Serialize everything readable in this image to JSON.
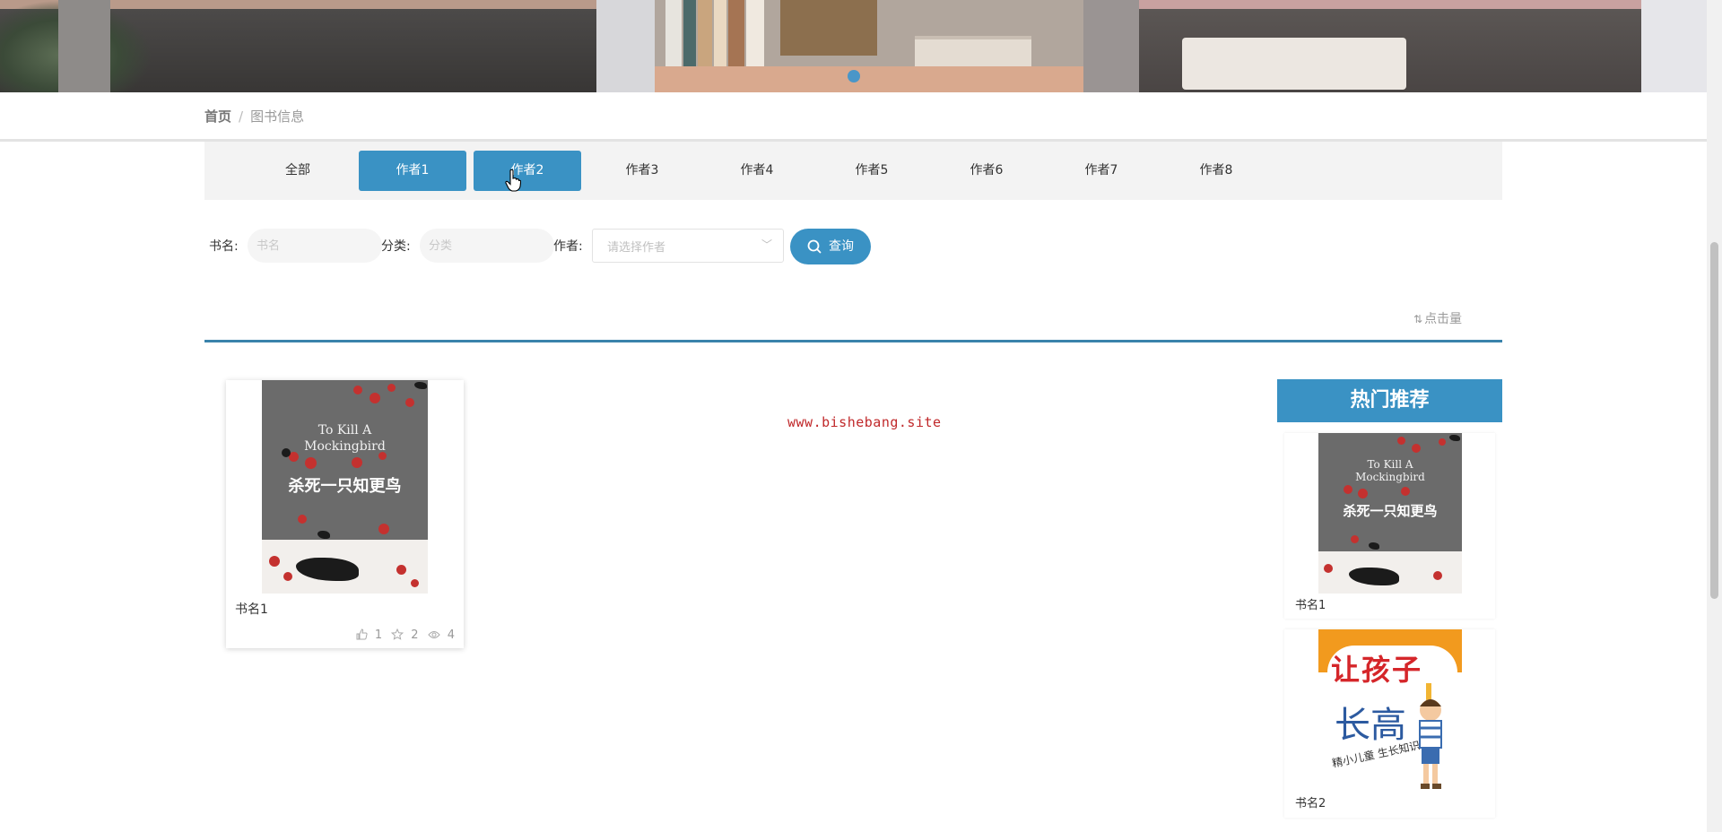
{
  "banner": {
    "slide_count": 1,
    "active_slide": 1
  },
  "breadcrumb": {
    "home": "首页",
    "separator": "/",
    "current": "图书信息"
  },
  "author_tabs": [
    {
      "label": "全部",
      "active": false
    },
    {
      "label": "作者1",
      "active": true
    },
    {
      "label": "作者2",
      "active": true
    },
    {
      "label": "作者3",
      "active": false
    },
    {
      "label": "作者4",
      "active": false
    },
    {
      "label": "作者5",
      "active": false
    },
    {
      "label": "作者6",
      "active": false
    },
    {
      "label": "作者7",
      "active": false
    },
    {
      "label": "作者8",
      "active": false
    }
  ],
  "search": {
    "name_label": "书名:",
    "name_placeholder": "书名",
    "category_label": "分类:",
    "category_placeholder": "分类",
    "author_label": "作者:",
    "author_placeholder": "请选择作者",
    "button_label": "查询"
  },
  "sort": {
    "label": "点击量"
  },
  "books": [
    {
      "name": "书名1",
      "cover": {
        "title_en_1": "To Kill A",
        "title_en_2": "Mockingbird",
        "title_cn": "杀死一只知更鸟"
      },
      "likes": "1",
      "favorites": "2",
      "views": "4"
    }
  ],
  "watermark": "www.bishebang.site",
  "hot": {
    "title": "热门推荐",
    "items": [
      {
        "name": "书名1",
        "cover": {
          "title_en_1": "To Kill A",
          "title_en_2": "Mockingbird",
          "title_cn": "杀死一只知更鸟"
        }
      },
      {
        "name": "书名2",
        "cover": {
          "line1": "让孩子",
          "line2": "长高",
          "sub": "精小儿童 生长知识问答"
        }
      }
    ]
  },
  "colors": {
    "accent": "#3a92c4",
    "watermark": "#c0282a",
    "tab_bar": "#f3f3f3"
  }
}
